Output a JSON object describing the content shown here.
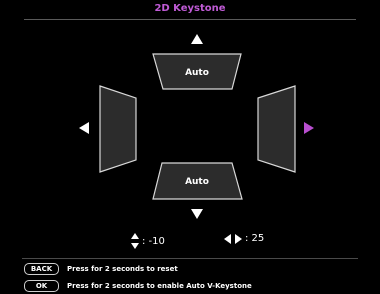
{
  "title": "2D Keystone",
  "shapes": {
    "top_label": "Auto",
    "bottom_label": "Auto"
  },
  "readouts": {
    "vertical_value": ": -10",
    "horizontal_value": ": 25"
  },
  "hints": [
    {
      "key": "BACK",
      "text": "Press for 2 seconds to reset"
    },
    {
      "key": "OK",
      "text": "Press for 2 seconds to enable Auto V-Keystone"
    }
  ],
  "colors": {
    "accent": "#c05bd6",
    "arrow": "#ffffff",
    "selected_arrow": "#b94fd0",
    "shape_fill": "#2c2c2c",
    "shape_stroke": "#d8d8d8"
  },
  "icons": {
    "up": "triangle-up-icon",
    "down": "triangle-down-icon",
    "left": "triangle-left-icon",
    "right": "triangle-right-icon",
    "vertical": "up-down-arrows-icon",
    "horizontal": "left-right-arrows-icon"
  }
}
